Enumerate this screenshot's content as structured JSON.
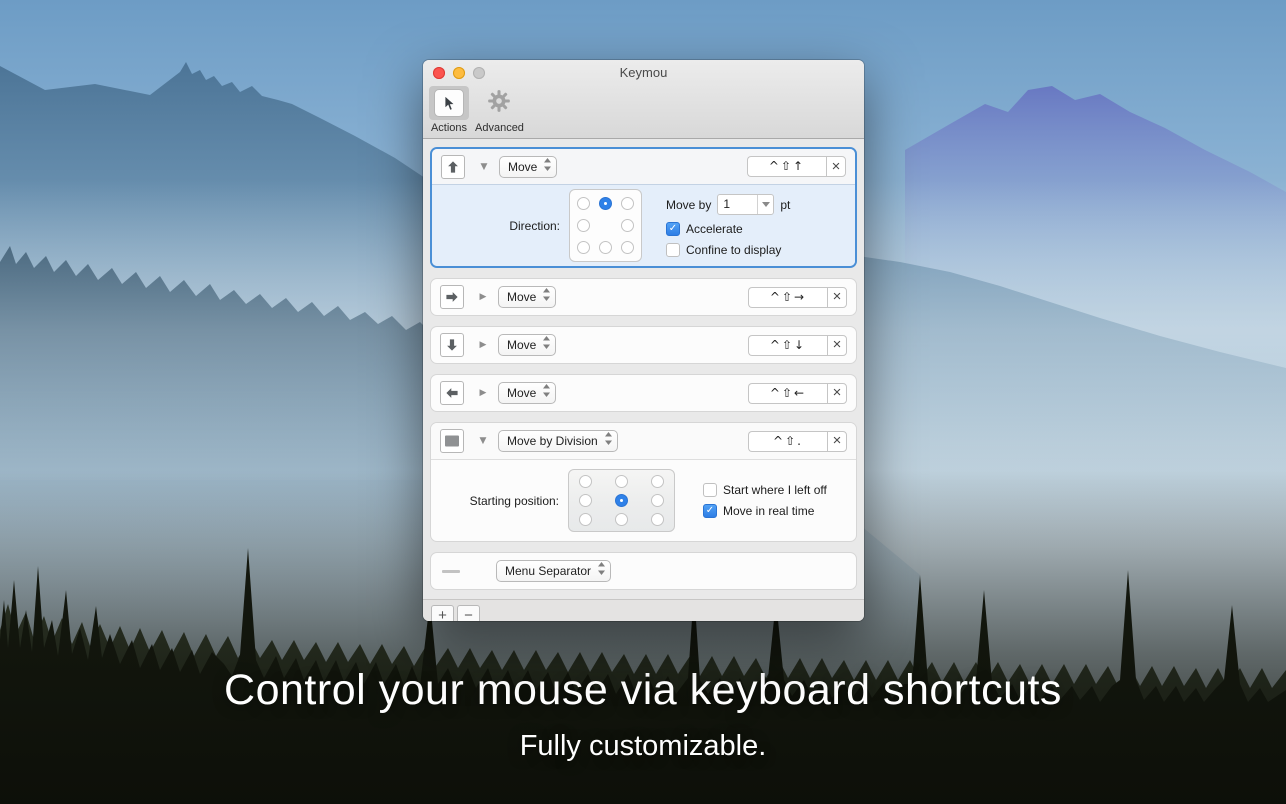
{
  "window": {
    "title": "Keymou",
    "toolbar": {
      "items": [
        {
          "label": "Actions",
          "selected": true
        },
        {
          "label": "Advanced",
          "selected": false
        }
      ]
    },
    "rows": [
      {
        "icon": "arrow-up",
        "action": "Move",
        "shortcut": "^⇧↑",
        "expanded": true,
        "selected": true,
        "details": {
          "direction_label": "Direction:",
          "move_by_label": "Move by",
          "move_by_value": "1",
          "move_by_unit": "pt",
          "checkboxes": [
            {
              "label": "Accelerate",
              "checked": true
            },
            {
              "label": "Confine to display",
              "checked": false
            }
          ]
        }
      },
      {
        "icon": "arrow-right",
        "action": "Move",
        "shortcut": "^⇧→",
        "expanded": false
      },
      {
        "icon": "arrow-down",
        "action": "Move",
        "shortcut": "^⇧↓",
        "expanded": false
      },
      {
        "icon": "arrow-left",
        "action": "Move",
        "shortcut": "^⇧←",
        "expanded": false
      },
      {
        "icon": "display",
        "action": "Move by Division",
        "shortcut": "^⇧.",
        "expanded": true,
        "details": {
          "position_label": "Starting position:",
          "checkboxes": [
            {
              "label": "Start where I left off",
              "checked": false
            },
            {
              "label": "Move in real time",
              "checked": true
            }
          ]
        }
      },
      {
        "icon": "separator-line",
        "action": "Menu Separator",
        "expanded": false
      }
    ],
    "footer": {
      "add": "+",
      "remove": "−"
    }
  },
  "glyphs": {
    "disclosure_open": "▼",
    "disclosure_closed": "▶",
    "close": "×",
    "check": "✓"
  },
  "hero": {
    "headline": "Control your mouse via keyboard shortcuts",
    "subheadline": "Fully customizable."
  },
  "colors": {
    "accent_blue": "#2f81e8",
    "selected_border": "#4a8fd6",
    "selected_bg": "#e4eefa",
    "traffic_red": "#fb544f",
    "traffic_yellow": "#fdbc40",
    "traffic_gray": "#c9c9c9"
  }
}
